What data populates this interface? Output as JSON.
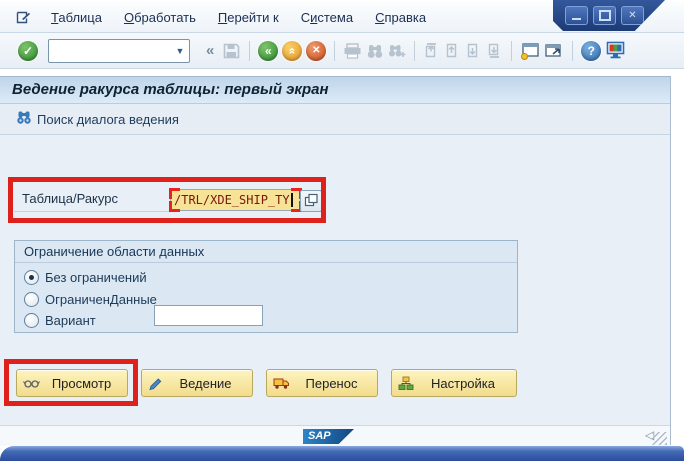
{
  "glyphs": {
    "check": "✓",
    "collapse": "«",
    "combo_arrow": "▼",
    "back": "«",
    "exit": "«",
    "cancel": "✕",
    "help": "?",
    "close": "✕",
    "nav_back_triangle": "◁"
  },
  "menu": {
    "items": [
      {
        "pre": "",
        "key": "Т",
        "post": "аблица"
      },
      {
        "pre": "",
        "key": "О",
        "post": "бработать"
      },
      {
        "pre": "",
        "key": "П",
        "post": "ерейти к"
      },
      {
        "pre": "С",
        "key": "и",
        "post": "стема"
      },
      {
        "pre": "",
        "key": "С",
        "post": "правка"
      }
    ]
  },
  "toolbar": {
    "command_value": ""
  },
  "screen": {
    "title": "Ведение ракурса таблицы: первый экран"
  },
  "app_toolbar": {
    "find_button": "Поиск диалога ведения"
  },
  "form": {
    "table_view_label": "Таблица/Ракурс",
    "table_view_value": "/TRL/XDE_SHIP_TY",
    "scope": {
      "title": "Ограничение области данных",
      "options": [
        {
          "label": "Без ограничений",
          "selected": true
        },
        {
          "label": "ОграниченДанные",
          "selected": false
        },
        {
          "label": "Вариант",
          "selected": false
        }
      ],
      "variant_value": ""
    }
  },
  "actions": {
    "display": "Просмотр",
    "maintain": "Ведение",
    "transport": "Перенос",
    "customizing": "Настройка"
  },
  "footer": {
    "logo_text": "SAP"
  },
  "colors": {
    "annotation_red": "#df211b",
    "field_highlight_yellow": "#f7e395",
    "button_yellow": "#f2dc8c",
    "title_bar_blue": "#c0d5e9",
    "frame_blue": "#2c4c9c"
  }
}
